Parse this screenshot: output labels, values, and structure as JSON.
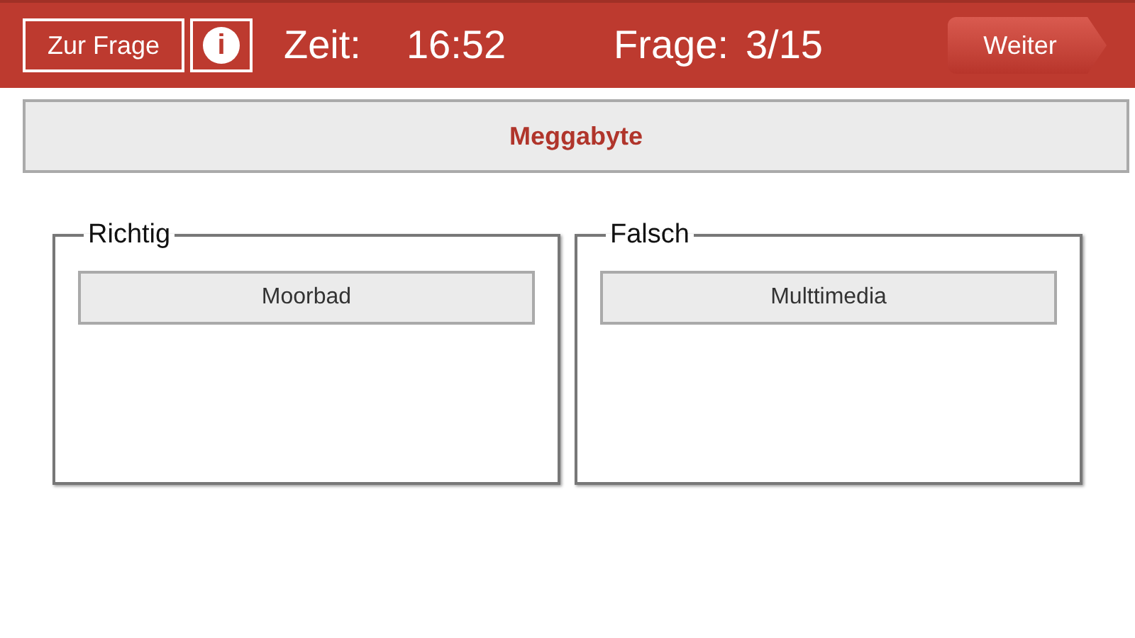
{
  "header": {
    "back_button": "Zur Frage",
    "info_button": "i",
    "time_label": "Zeit:",
    "time": "16:52",
    "question_label": "Frage:",
    "question_progress": "3/15",
    "next_button": "Weiter"
  },
  "question": "Meggabyte",
  "groups": [
    {
      "title": "Richtig",
      "items": [
        "Moorbad"
      ]
    },
    {
      "title": "Falsch",
      "items": [
        "Multtimedia"
      ]
    }
  ]
}
